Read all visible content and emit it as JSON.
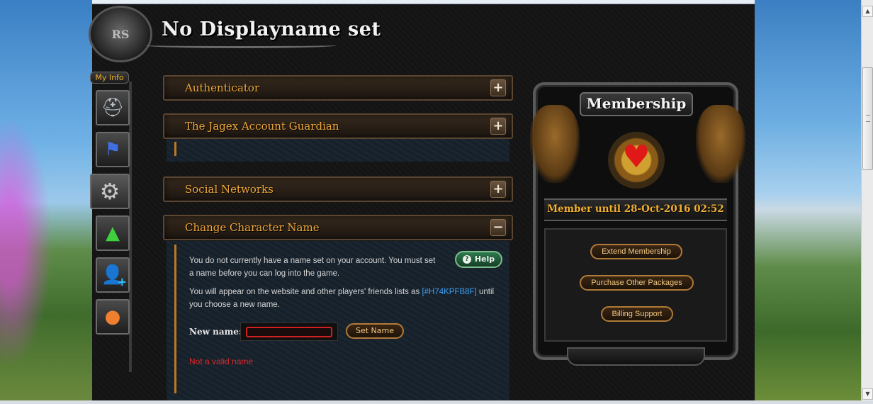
{
  "page": {
    "title": "No Displayname set",
    "logo_text": "RS"
  },
  "sidebar": {
    "myinfo_label": "My Info",
    "items": [
      {
        "name": "helm",
        "icon": "helmet-icon"
      },
      {
        "name": "banner",
        "icon": "banner-icon"
      },
      {
        "name": "settings",
        "icon": "gear-icon"
      },
      {
        "name": "upgrade",
        "icon": "level-up-icon"
      },
      {
        "name": "add-friend",
        "icon": "add-user-icon"
      },
      {
        "name": "orb",
        "icon": "orb-icon"
      }
    ]
  },
  "sections": {
    "authenticator": {
      "label": "Authenticator",
      "toggle": "+"
    },
    "guardian": {
      "label": "The Jagex Account Guardian",
      "toggle": "+"
    },
    "social": {
      "label": "Social Networks",
      "toggle": "+"
    },
    "change_name": {
      "label": "Change Character Name",
      "toggle": "−",
      "desc1": "You do not currently have a name set on your account. You must set a name before you can log into the game.",
      "desc2_pre": "You will appear on the website and other players' friends lists as",
      "desc2_code": "[#H74KPFB8F]",
      "desc2_post": "until you choose a new name.",
      "help_label": "Help",
      "help_icon": "?",
      "new_name_label": "New name:",
      "new_name_value": "",
      "set_name_label": "Set Name",
      "error": "Not a valid name"
    }
  },
  "membership": {
    "title": "Membership",
    "until": "Member until 28-Oct-2016 02:52",
    "buttons": [
      "Extend Membership",
      "Purchase Other Packages",
      "Billing Support"
    ]
  },
  "colors": {
    "accent_gold": "#f0a83a",
    "error_red": "#e02828",
    "code_blue": "#3ea0f0",
    "help_green": "#2e7a4e"
  }
}
